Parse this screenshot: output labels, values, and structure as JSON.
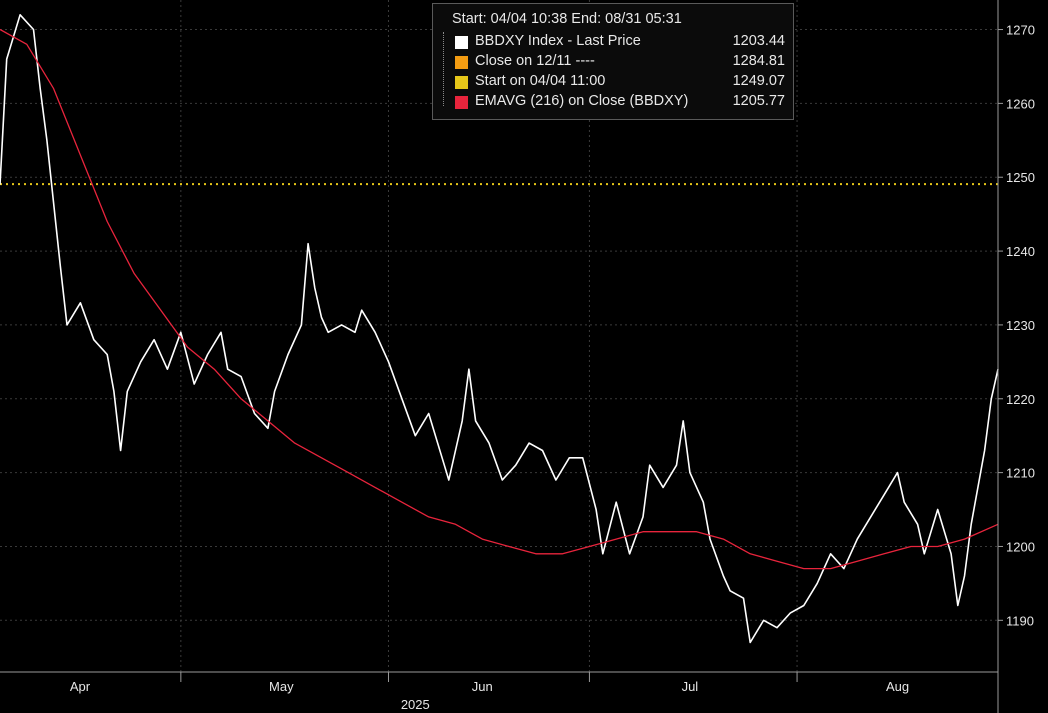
{
  "legend": {
    "header": "Start: 04/04 10:38 End: 08/31 05:31",
    "items": [
      {
        "label": "BBDXY Index - Last Price",
        "value": "1203.44",
        "color": "#ffffff"
      },
      {
        "label": "Close on 12/11 ----",
        "value": "1284.81",
        "color": "#f39c12"
      },
      {
        "label": "Start on 04/04 11:00",
        "value": "1249.07",
        "color": "#e6c619"
      },
      {
        "label": "EMAVG (216)  on Close (BBDXY)",
        "value": "1205.77",
        "color": "#e8243c"
      }
    ]
  },
  "chart_data": {
    "type": "line",
    "title": "",
    "xlabel": "",
    "ylabel": "",
    "ylim": [
      1183,
      1274
    ],
    "xlim": [
      "2025-04-04",
      "2025-08-31"
    ],
    "x_tick_labels": [
      "Apr",
      "May",
      "Jun",
      "Jul",
      "Aug"
    ],
    "x_year_label": "2025",
    "y_ticks": [
      1190,
      1200,
      1210,
      1220,
      1230,
      1240,
      1250,
      1260,
      1270
    ],
    "grid": true,
    "legend_position": "top-center",
    "series": [
      {
        "name": "BBDXY Index - Last Price",
        "color": "#ffffff",
        "points": [
          [
            "2025-04-04",
            1249.0
          ],
          [
            "2025-04-05",
            1266.0
          ],
          [
            "2025-04-07",
            1272.0
          ],
          [
            "2025-04-09",
            1270.0
          ],
          [
            "2025-04-10",
            1262.0
          ],
          [
            "2025-04-11",
            1255.0
          ],
          [
            "2025-04-13",
            1238.0
          ],
          [
            "2025-04-14",
            1230.0
          ],
          [
            "2025-04-16",
            1233.0
          ],
          [
            "2025-04-18",
            1228.0
          ],
          [
            "2025-04-20",
            1226.0
          ],
          [
            "2025-04-21",
            1221.0
          ],
          [
            "2025-04-22",
            1213.0
          ],
          [
            "2025-04-23",
            1221.0
          ],
          [
            "2025-04-25",
            1225.0
          ],
          [
            "2025-04-27",
            1228.0
          ],
          [
            "2025-04-29",
            1224.0
          ],
          [
            "2025-05-01",
            1229.0
          ],
          [
            "2025-05-03",
            1222.0
          ],
          [
            "2025-05-05",
            1226.0
          ],
          [
            "2025-05-07",
            1229.0
          ],
          [
            "2025-05-08",
            1224.0
          ],
          [
            "2025-05-10",
            1223.0
          ],
          [
            "2025-05-12",
            1218.0
          ],
          [
            "2025-05-14",
            1216.0
          ],
          [
            "2025-05-15",
            1221.0
          ],
          [
            "2025-05-17",
            1226.0
          ],
          [
            "2025-05-19",
            1230.0
          ],
          [
            "2025-05-20",
            1241.0
          ],
          [
            "2025-05-21",
            1235.0
          ],
          [
            "2025-05-22",
            1231.0
          ],
          [
            "2025-05-23",
            1229.0
          ],
          [
            "2025-05-25",
            1230.0
          ],
          [
            "2025-05-27",
            1229.0
          ],
          [
            "2025-05-28",
            1232.0
          ],
          [
            "2025-05-30",
            1229.0
          ],
          [
            "2025-06-01",
            1225.0
          ],
          [
            "2025-06-03",
            1220.0
          ],
          [
            "2025-06-05",
            1215.0
          ],
          [
            "2025-06-07",
            1218.0
          ],
          [
            "2025-06-09",
            1212.0
          ],
          [
            "2025-06-10",
            1209.0
          ],
          [
            "2025-06-12",
            1217.0
          ],
          [
            "2025-06-13",
            1224.0
          ],
          [
            "2025-06-14",
            1217.0
          ],
          [
            "2025-06-16",
            1214.0
          ],
          [
            "2025-06-18",
            1209.0
          ],
          [
            "2025-06-20",
            1211.0
          ],
          [
            "2025-06-22",
            1214.0
          ],
          [
            "2025-06-24",
            1213.0
          ],
          [
            "2025-06-26",
            1209.0
          ],
          [
            "2025-06-28",
            1212.0
          ],
          [
            "2025-06-30",
            1212.0
          ],
          [
            "2025-07-02",
            1205.0
          ],
          [
            "2025-07-03",
            1199.0
          ],
          [
            "2025-07-05",
            1206.0
          ],
          [
            "2025-07-07",
            1199.0
          ],
          [
            "2025-07-09",
            1204.0
          ],
          [
            "2025-07-10",
            1211.0
          ],
          [
            "2025-07-12",
            1208.0
          ],
          [
            "2025-07-14",
            1211.0
          ],
          [
            "2025-07-15",
            1217.0
          ],
          [
            "2025-07-16",
            1210.0
          ],
          [
            "2025-07-18",
            1206.0
          ],
          [
            "2025-07-19",
            1201.0
          ],
          [
            "2025-07-21",
            1196.0
          ],
          [
            "2025-07-22",
            1194.0
          ],
          [
            "2025-07-24",
            1193.0
          ],
          [
            "2025-07-25",
            1187.0
          ],
          [
            "2025-07-27",
            1190.0
          ],
          [
            "2025-07-29",
            1189.0
          ],
          [
            "2025-07-31",
            1191.0
          ],
          [
            "2025-08-02",
            1192.0
          ],
          [
            "2025-08-04",
            1195.0
          ],
          [
            "2025-08-06",
            1199.0
          ],
          [
            "2025-08-08",
            1197.0
          ],
          [
            "2025-08-10",
            1201.0
          ],
          [
            "2025-08-12",
            1204.0
          ],
          [
            "2025-08-14",
            1207.0
          ],
          [
            "2025-08-16",
            1210.0
          ],
          [
            "2025-08-17",
            1206.0
          ],
          [
            "2025-08-19",
            1203.0
          ],
          [
            "2025-08-20",
            1199.0
          ],
          [
            "2025-08-22",
            1205.0
          ],
          [
            "2025-08-24",
            1199.0
          ],
          [
            "2025-08-25",
            1192.0
          ],
          [
            "2025-08-26",
            1196.0
          ],
          [
            "2025-08-27",
            1203.0
          ],
          [
            "2025-08-28",
            1208.0
          ],
          [
            "2025-08-29",
            1213.0
          ],
          [
            "2025-08-30",
            1220.0
          ],
          [
            "2025-08-31",
            1224.0
          ]
        ]
      },
      {
        "name": "EMAVG (216)  on Close (BBDXY)",
        "color": "#e8243c",
        "points": [
          [
            "2025-04-04",
            1270.0
          ],
          [
            "2025-04-08",
            1268.0
          ],
          [
            "2025-04-12",
            1262.0
          ],
          [
            "2025-04-16",
            1253.0
          ],
          [
            "2025-04-20",
            1244.0
          ],
          [
            "2025-04-24",
            1237.0
          ],
          [
            "2025-04-28",
            1232.0
          ],
          [
            "2025-05-02",
            1227.0
          ],
          [
            "2025-05-06",
            1224.0
          ],
          [
            "2025-05-10",
            1220.0
          ],
          [
            "2025-05-14",
            1217.0
          ],
          [
            "2025-05-18",
            1214.0
          ],
          [
            "2025-05-22",
            1212.0
          ],
          [
            "2025-05-26",
            1210.0
          ],
          [
            "2025-05-30",
            1208.0
          ],
          [
            "2025-06-03",
            1206.0
          ],
          [
            "2025-06-07",
            1204.0
          ],
          [
            "2025-06-11",
            1203.0
          ],
          [
            "2025-06-15",
            1201.0
          ],
          [
            "2025-06-19",
            1200.0
          ],
          [
            "2025-06-23",
            1199.0
          ],
          [
            "2025-06-27",
            1199.0
          ],
          [
            "2025-07-01",
            1200.0
          ],
          [
            "2025-07-05",
            1201.0
          ],
          [
            "2025-07-09",
            1202.0
          ],
          [
            "2025-07-13",
            1202.0
          ],
          [
            "2025-07-17",
            1202.0
          ],
          [
            "2025-07-21",
            1201.0
          ],
          [
            "2025-07-25",
            1199.0
          ],
          [
            "2025-07-29",
            1198.0
          ],
          [
            "2025-08-02",
            1197.0
          ],
          [
            "2025-08-06",
            1197.0
          ],
          [
            "2025-08-10",
            1198.0
          ],
          [
            "2025-08-14",
            1199.0
          ],
          [
            "2025-08-18",
            1200.0
          ],
          [
            "2025-08-22",
            1200.0
          ],
          [
            "2025-08-26",
            1201.0
          ],
          [
            "2025-08-31",
            1203.0
          ]
        ]
      }
    ],
    "reference_lines": [
      {
        "name": "Start on 04/04 11:00",
        "y": 1249.07,
        "style": "dotted",
        "color": "#e6c619"
      },
      {
        "name": "Close on 12/11 ----",
        "y": 1284.81,
        "style": "dashed",
        "color": "#f39c12"
      }
    ]
  }
}
